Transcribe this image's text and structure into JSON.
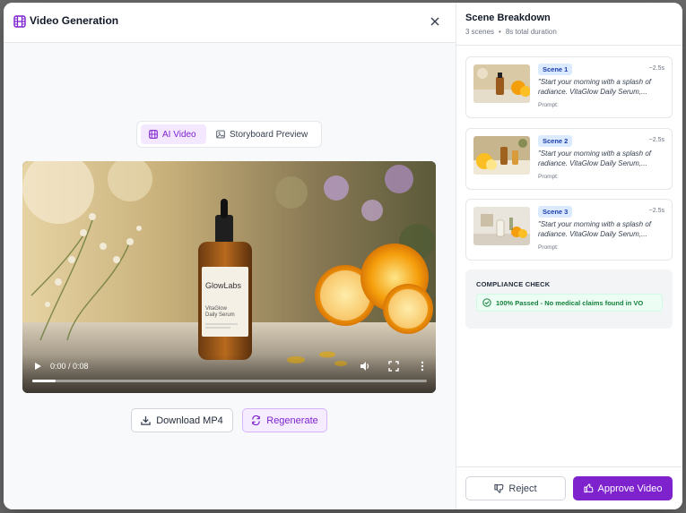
{
  "header": {
    "title": "Video Generation",
    "icon": "film-icon",
    "close_icon": "close-icon"
  },
  "tabs": [
    {
      "label": "AI Video",
      "icon": "film-icon",
      "active": true
    },
    {
      "label": "Storyboard Preview",
      "icon": "image-icon",
      "active": false
    }
  ],
  "player": {
    "time": "0:00 / 0:08",
    "progress": 0.06,
    "product_brand": "GlowLabs",
    "product_name_line1": "VitaGlow",
    "product_name_line2": "Daily Serum"
  },
  "actions": {
    "download_label": "Download MP4",
    "regenerate_label": "Regenerate"
  },
  "breakdown": {
    "title": "Scene Breakdown",
    "scene_count": "3 scenes",
    "duration": "8s total duration",
    "scenes": [
      {
        "label": "Scene 1",
        "duration": "~2.5s",
        "text": "\"Start your morning with a splash of radiance. VitaGlow Daily Serum,...",
        "prompt_label": "Prompt:"
      },
      {
        "label": "Scene 2",
        "duration": "~2.5s",
        "text": "\"Start your morning with a splash of radiance. VitaGlow Daily Serum,...",
        "prompt_label": "Prompt:"
      },
      {
        "label": "Scene 3",
        "duration": "~2.5s",
        "text": "\"Start your morning with a splash of radiance. VitaGlow Daily Serum,...",
        "prompt_label": "Prompt:"
      }
    ]
  },
  "compliance": {
    "title": "COMPLIANCE CHECK",
    "status": "100% Passed - No medical claims found in VO"
  },
  "footer": {
    "reject_label": "Reject",
    "approve_label": "Approve Video"
  },
  "colors": {
    "accent": "#7e22ce",
    "accent_light": "#f3e8ff",
    "badge_blue": "#dbeafe",
    "success": "#15803d"
  }
}
